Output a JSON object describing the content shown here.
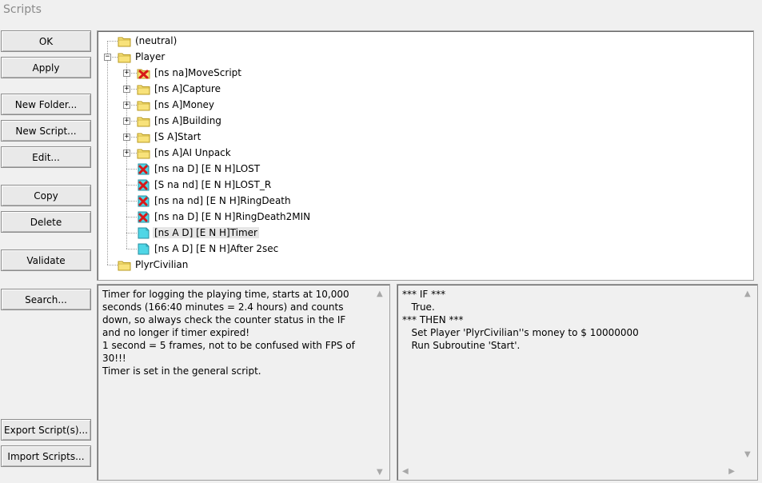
{
  "window": {
    "title": "Scripts"
  },
  "buttons": {
    "ok": "OK",
    "apply": "Apply",
    "new_folder": "New Folder...",
    "new_script": "New Script...",
    "edit": "Edit...",
    "copy": "Copy",
    "delete": "Delete",
    "validate": "Validate",
    "search": "Search...",
    "export_scripts": "Export Script(s)...",
    "import_scripts": "Import Scripts..."
  },
  "tree": [
    {
      "label": "(neutral)",
      "type": "folder",
      "depth": 0,
      "expander": "none"
    },
    {
      "label": "Player",
      "type": "folder",
      "depth": 0,
      "expander": "minus"
    },
    {
      "label": "[ns na]MoveScript",
      "type": "folder-disabled",
      "depth": 1,
      "expander": "plus"
    },
    {
      "label": "[ns A]Capture",
      "type": "folder",
      "depth": 1,
      "expander": "plus"
    },
    {
      "label": "[ns A]Money",
      "type": "folder",
      "depth": 1,
      "expander": "plus"
    },
    {
      "label": "[ns A]Building",
      "type": "folder",
      "depth": 1,
      "expander": "plus"
    },
    {
      "label": "[S A]Start",
      "type": "folder",
      "depth": 1,
      "expander": "plus"
    },
    {
      "label": "[ns A]AI Unpack",
      "type": "folder",
      "depth": 1,
      "expander": "plus"
    },
    {
      "label": "[ns na D] [E N H]LOST",
      "type": "script-disabled",
      "depth": 1,
      "expander": "none"
    },
    {
      "label": "[S na nd] [E N H]LOST_R",
      "type": "script-disabled",
      "depth": 1,
      "expander": "none"
    },
    {
      "label": "[ns na nd] [E N H]RingDeath",
      "type": "script-disabled",
      "depth": 1,
      "expander": "none"
    },
    {
      "label": "[ns na D] [E N H]RingDeath2MIN",
      "type": "script-disabled",
      "depth": 1,
      "expander": "none"
    },
    {
      "label": "[ns A D] [E N H]Timer",
      "type": "script",
      "depth": 1,
      "expander": "none",
      "selected": true
    },
    {
      "label": "[ns A D] [E N H]After 2sec",
      "type": "script",
      "depth": 1,
      "expander": "none"
    },
    {
      "label": "PlyrCivilian",
      "type": "folder",
      "depth": 0,
      "expander": "none"
    }
  ],
  "description": "Timer for logging the playing time, starts at 10,000\nseconds (166:40 minutes = 2.4 hours) and counts\ndown, so always check the counter status in the IF\nand no longer if timer expired!\n1 second = 5 frames, not to be confused with FPS of\n30!!!\nTimer is set in the general script.",
  "code": "*** IF ***\n   True.\n*** THEN ***\n   Set Player 'PlyrCivilian''s money to $ 10000000\n   Run Subroutine 'Start'.",
  "colors": {
    "folder_fill": "#f8e27a",
    "folder_edge": "#b89a20",
    "script_fill": "#4fd6e6",
    "disabled_x": "#d81818",
    "selection": "#e6e6e6"
  }
}
